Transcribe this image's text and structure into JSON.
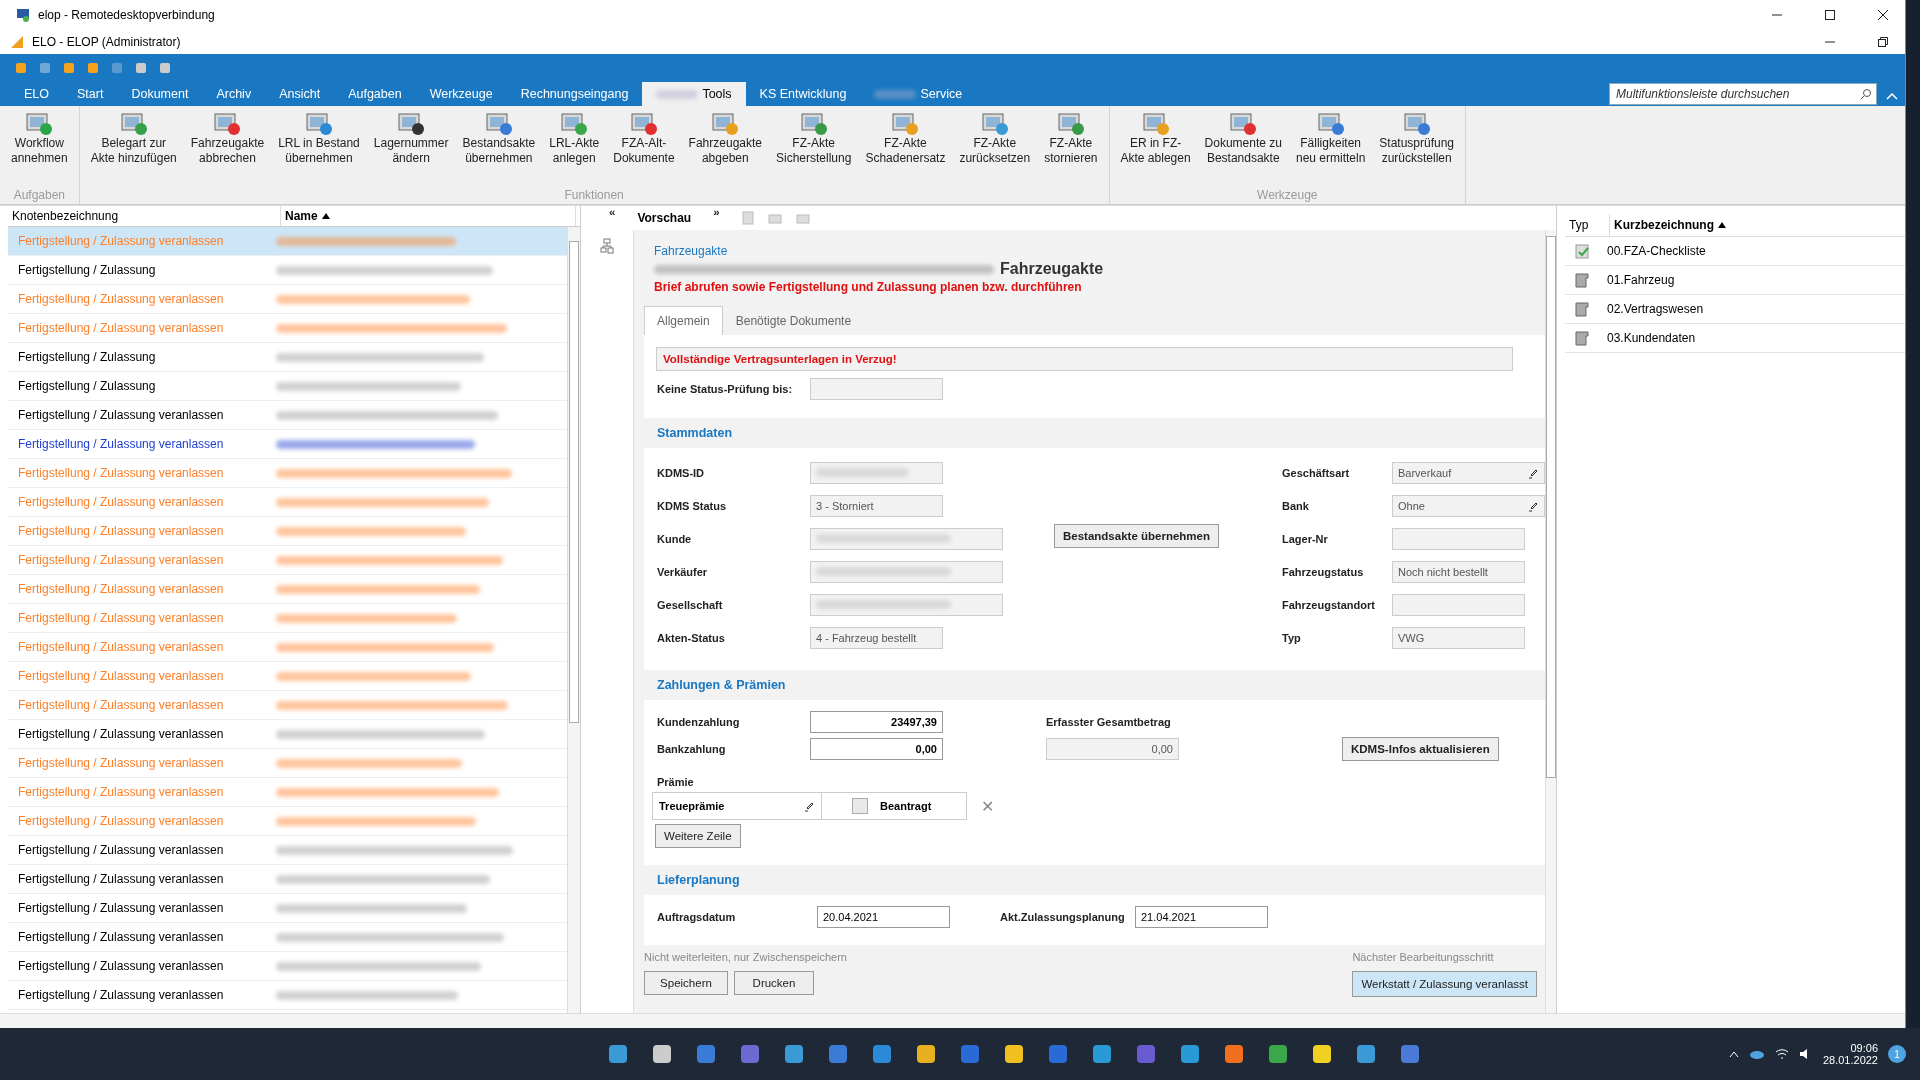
{
  "window": {
    "title": "elop - Remotedesktopverbindung"
  },
  "app": {
    "title": "ELO - ELOP (Administrator)"
  },
  "ribbon_tabs": [
    {
      "label": "ELO",
      "selected": false
    },
    {
      "label": "Start",
      "selected": false
    },
    {
      "label": "Dokument",
      "selected": false
    },
    {
      "label": "Archiv",
      "selected": false
    },
    {
      "label": "Ansicht",
      "selected": false
    },
    {
      "label": "Aufgaben",
      "selected": false
    },
    {
      "label": "Werkzeuge",
      "selected": false
    },
    {
      "label": "Rechnungseingang",
      "selected": false
    },
    {
      "label": "Tools",
      "selected": true,
      "redacted_prefix": true
    },
    {
      "label": "KS Entwicklung",
      "selected": false
    },
    {
      "label": "Service",
      "selected": false,
      "redacted_prefix": true
    }
  ],
  "search": {
    "placeholder": "Multifunktionsleiste durchsuchen"
  },
  "ribbon_groups": [
    {
      "label": "Aufgaben",
      "buttons": [
        "Workflow\nannehmen"
      ]
    },
    {
      "label": "Funktionen",
      "buttons": [
        "Belegart zur\nAkte hinzufügen",
        "Fahrzeugakte\nabbrechen",
        "LRL in Bestand\nübernehmen",
        "Lagernummer\nändern",
        "Bestandsakte\nübernehmen",
        "LRL-Akte\nanlegen",
        "FZA-Alt-\nDokumente",
        "Fahrzeugakte\nabgeben",
        "FZ-Akte\nSicherstellung",
        "FZ-Akte\nSchadenersatz",
        "FZ-Akte\nzurücksetzen",
        "FZ-Akte\nstornieren"
      ]
    },
    {
      "label": "Werkzeuge",
      "buttons": [
        "ER in FZ-\nAkte ablegen",
        "Dokumente zu\nBestandsakte",
        "Fälligkeiten\nneu ermitteln",
        "Statusprüfung\nzurückstellen"
      ]
    }
  ],
  "tree": {
    "columns": [
      "Knotenbezeichnung",
      "Name"
    ],
    "rows": [
      {
        "node": "Fertigstellung / Zulassung veranlassen",
        "color": "#ff7f27",
        "selected": true
      },
      {
        "node": "Fertigstellung / Zulassung",
        "color": "#000000",
        "selected": false
      },
      {
        "node": "Fertigstellung / Zulassung veranlassen",
        "color": "#ff7f27",
        "selected": false
      },
      {
        "node": "Fertigstellung / Zulassung veranlassen",
        "color": "#ff7f27",
        "selected": false
      },
      {
        "node": "Fertigstellung / Zulassung",
        "color": "#000000",
        "selected": false
      },
      {
        "node": "Fertigstellung / Zulassung",
        "color": "#000000",
        "selected": false
      },
      {
        "node": "Fertigstellung / Zulassung veranlassen",
        "color": "#000000",
        "selected": false
      },
      {
        "node": "Fertigstellung / Zulassung veranlassen",
        "color": "#1f3fd0",
        "selected": false
      },
      {
        "node": "Fertigstellung / Zulassung veranlassen",
        "color": "#ff7f27",
        "selected": false
      },
      {
        "node": "Fertigstellung / Zulassung veranlassen",
        "color": "#ff7f27",
        "selected": false
      },
      {
        "node": "Fertigstellung / Zulassung veranlassen",
        "color": "#ff7f27",
        "selected": false
      },
      {
        "node": "Fertigstellung / Zulassung veranlassen",
        "color": "#ff7f27",
        "selected": false
      },
      {
        "node": "Fertigstellung / Zulassung veranlassen",
        "color": "#ff7f27",
        "selected": false
      },
      {
        "node": "Fertigstellung / Zulassung veranlassen",
        "color": "#ff7f27",
        "selected": false
      },
      {
        "node": "Fertigstellung / Zulassung veranlassen",
        "color": "#ff7f27",
        "selected": false
      },
      {
        "node": "Fertigstellung / Zulassung veranlassen",
        "color": "#ff7f27",
        "selected": false
      },
      {
        "node": "Fertigstellung / Zulassung veranlassen",
        "color": "#ff7f27",
        "selected": false
      },
      {
        "node": "Fertigstellung / Zulassung veranlassen",
        "color": "#000000",
        "selected": false
      },
      {
        "node": "Fertigstellung / Zulassung veranlassen",
        "color": "#ff7f27",
        "selected": false
      },
      {
        "node": "Fertigstellung / Zulassung veranlassen",
        "color": "#ff7f27",
        "selected": false
      },
      {
        "node": "Fertigstellung / Zulassung veranlassen",
        "color": "#ff7f27",
        "selected": false
      },
      {
        "node": "Fertigstellung / Zulassung veranlassen",
        "color": "#000000",
        "selected": false
      },
      {
        "node": "Fertigstellung / Zulassung veranlassen",
        "color": "#000000",
        "selected": false
      },
      {
        "node": "Fertigstellung / Zulassung veranlassen",
        "color": "#000000",
        "selected": false
      },
      {
        "node": "Fertigstellung / Zulassung veranlassen",
        "color": "#000000",
        "selected": false
      },
      {
        "node": "Fertigstellung / Zulassung veranlassen",
        "color": "#000000",
        "selected": false
      },
      {
        "node": "Fertigstellung / Zulassung veranlassen",
        "color": "#000000",
        "selected": false
      }
    ]
  },
  "preview": {
    "label": "Vorschau",
    "collapse": "«",
    "expand": "»"
  },
  "form": {
    "breadcrumb": "Fahrzeugakte",
    "title": "Fahrzeugakte",
    "subtitle": "Brief abrufen sowie Fertigstellung und Zulassung planen bzw. durchführen",
    "tabs": [
      {
        "label": "Allgemein",
        "selected": true
      },
      {
        "label": "Benötigte Dokumente",
        "selected": false
      }
    ],
    "warning": "Vollständige Vertragsunterlagen in Verzug!",
    "status_check": {
      "label": "Keine Status-Prüfung bis:"
    },
    "stammdaten": {
      "title": "Stammdaten",
      "left": [
        {
          "label": "KDMS-ID",
          "redacted": true
        },
        {
          "label": "KDMS Status",
          "value": "3 - Storniert"
        },
        {
          "label": "Kunde",
          "redacted": true,
          "wide": true
        },
        {
          "label": "Verkäufer",
          "redacted": true,
          "wide": true
        },
        {
          "label": "Gesellschaft",
          "redacted": true,
          "wide": true
        },
        {
          "label": "Akten-Status",
          "value": "4 - Fahrzeug bestellt"
        }
      ],
      "button": "Bestandsakte übernehmen",
      "right": [
        {
          "label": "Geschäftsart",
          "value": "Barverkauf",
          "pencil": true
        },
        {
          "label": "Bank",
          "value": "Ohne",
          "pencil": true
        },
        {
          "label": "Lager-Nr"
        },
        {
          "label": "Fahrzeugstatus",
          "value": "Noch nicht bestellt"
        },
        {
          "label": "Fahrzeugstandort"
        },
        {
          "label": "Typ",
          "value": "VWG"
        }
      ]
    },
    "zahlungen": {
      "title": "Zahlungen & Prämien",
      "kundenzahlung": {
        "label": "Kundenzahlung",
        "value": "23497,39"
      },
      "bankzahlung": {
        "label": "Bankzahlung",
        "value": "0,00"
      },
      "gesamt": {
        "label": "Erfasster Gesamtbetrag",
        "value": "0,00"
      },
      "update_button": "KDMS-Infos aktualisieren",
      "praemie": {
        "label": "Prämie",
        "name": "Treueprämie",
        "checkbox": "Beantragt",
        "checked": false,
        "remove": "✕"
      },
      "add_button": "Weitere Zeile"
    },
    "lieferplanung": {
      "title": "Lieferplanung",
      "auftragsdatum": {
        "label": "Auftragsdatum",
        "value": "20.04.2021"
      },
      "zulassung": {
        "label": "Akt.Zulassungsplanung",
        "value": "21.04.2021"
      }
    },
    "footer": {
      "note": "Nicht weiterleiten, nur Zwischenspeichern",
      "buttons": [
        "Speichern",
        "Drucken"
      ],
      "next_label": "Nächster Bearbeitungsschritt",
      "next_button": "Werkstatt / Zulassung veranlasst"
    }
  },
  "documents": {
    "columns": [
      "Typ",
      "Kurzbezeichnung"
    ],
    "rows": [
      {
        "kind": "checklist",
        "name": "00.FZA-Checkliste"
      },
      {
        "kind": "folder",
        "name": "01.Fahrzeug"
      },
      {
        "kind": "folder",
        "name": "02.Vertragswesen"
      },
      {
        "kind": "folder",
        "name": "03.Kundendaten"
      }
    ]
  },
  "taskbar": {
    "time": "09:06",
    "date": "28.01.2022",
    "notifications": "1"
  }
}
